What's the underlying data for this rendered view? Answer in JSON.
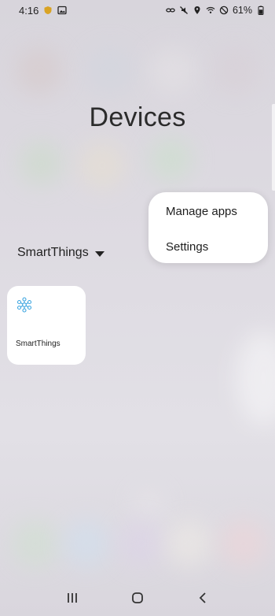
{
  "status": {
    "time": "4:16",
    "battery": "61%"
  },
  "page": {
    "title": "Devices"
  },
  "category": {
    "label": "SmartThings"
  },
  "menu": {
    "items": [
      "Manage apps",
      "Settings"
    ]
  },
  "device_card": {
    "label": "SmartThings",
    "icon": "smartthings-icon"
  },
  "colors": {
    "accent": "#3da5e0",
    "card": "#ffffff"
  }
}
